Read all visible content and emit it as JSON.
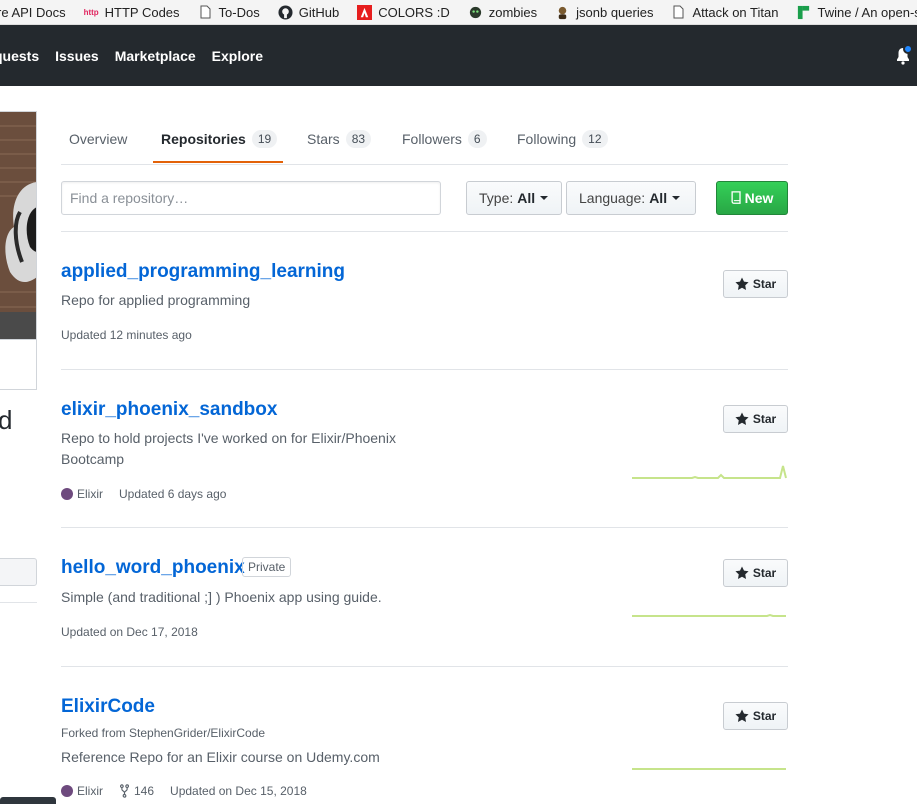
{
  "bookmarks": [
    {
      "label": "re API Docs",
      "icon": "doc-icon"
    },
    {
      "label": "HTTP Codes",
      "icon": "http-icon"
    },
    {
      "label": "To-Dos",
      "icon": "page-icon"
    },
    {
      "label": "GitHub",
      "icon": "github-icon"
    },
    {
      "label": "COLORS :D",
      "icon": "adobe-icon"
    },
    {
      "label": "zombies",
      "icon": "zombie-icon"
    },
    {
      "label": "jsonb queries",
      "icon": "person-icon"
    },
    {
      "label": "Attack on Titan",
      "icon": "page-icon"
    },
    {
      "label": "Twine / An open-s",
      "icon": "twine-icon"
    }
  ],
  "bookmark_http_tag": "http",
  "nav": {
    "items": [
      "quests",
      "Issues",
      "Marketplace",
      "Explore"
    ]
  },
  "sidebar": {
    "name_fragment": "d"
  },
  "tabs": [
    {
      "label": "Overview",
      "count": null
    },
    {
      "label": "Repositories",
      "count": "19"
    },
    {
      "label": "Stars",
      "count": "83"
    },
    {
      "label": "Followers",
      "count": "6"
    },
    {
      "label": "Following",
      "count": "12"
    }
  ],
  "filters": {
    "search_placeholder": "Find a repository…",
    "type_label": "Type:",
    "type_value": "All",
    "language_label": "Language:",
    "language_value": "All",
    "new_label": "New"
  },
  "star_label": "Star",
  "repos": [
    {
      "name": "applied_programming_learning",
      "description": "Repo for applied programming",
      "updated": "Updated 12 minutes ago"
    },
    {
      "name": "elixir_phoenix_sandbox",
      "description": "Repo to hold projects I've worked on for Elixir/Phoenix Bootcamp",
      "language": "Elixir",
      "updated": "Updated 6 days ago"
    },
    {
      "name": "hello_word_phoenix",
      "badge": "Private",
      "description": "Simple (and traditional ;] ) Phoenix app using guide.",
      "updated": "Updated on Dec 17, 2018"
    },
    {
      "name": "ElixirCode",
      "forked_from": "Forked from StephenGrider/ElixirCode",
      "description": "Reference Repo for an Elixir course on Udemy.com",
      "language": "Elixir",
      "forks": "146",
      "updated": "Updated on Dec 15, 2018"
    }
  ],
  "colors": {
    "header_bg": "#24292e",
    "link": "#0366d6",
    "accent_tab": "#e36209",
    "new_button": "#28a745",
    "elixir": "#6e4a7e",
    "sparkline": "#c3e88d"
  }
}
